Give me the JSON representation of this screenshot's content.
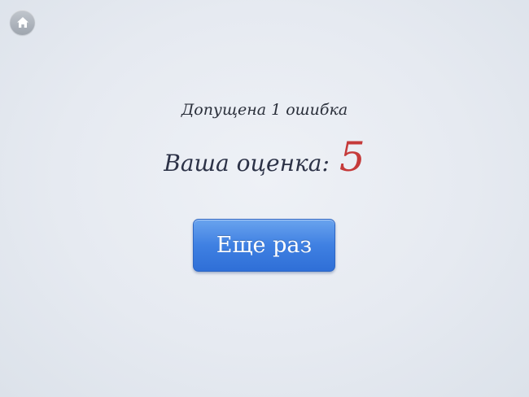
{
  "nav": {
    "home_icon": "home-icon"
  },
  "result": {
    "mistakes_text": "Допущена 1 ошибка",
    "grade_label": "Ваша оценка:",
    "grade_value": "5"
  },
  "actions": {
    "retry_label": "Еще раз"
  },
  "colors": {
    "grade": "#c53a3a",
    "button": "#3f80e2",
    "background": "#e6eaf1"
  }
}
